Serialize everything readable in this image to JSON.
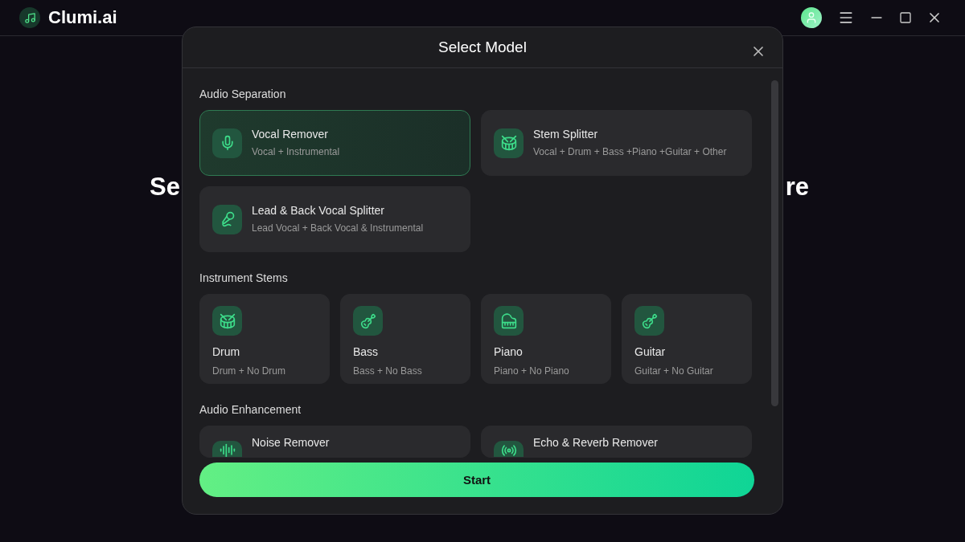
{
  "app": {
    "name": "Clumi.ai"
  },
  "background_heading": {
    "left_part": "Se",
    "right_part": "re"
  },
  "dialog": {
    "title": "Select Model",
    "sections": [
      {
        "title": "Audio Separation",
        "kind": "wide",
        "models": [
          {
            "name": "Vocal Remover",
            "description": "Vocal + Instrumental",
            "selected": true
          },
          {
            "name": "Stem Splitter",
            "description": "Vocal + Drum + Bass +Piano +Guitar + Other",
            "selected": false
          },
          {
            "name": "Lead & Back Vocal Splitter",
            "description": "Lead Vocal + Back Vocal & Instrumental",
            "selected": false
          }
        ]
      },
      {
        "title": "Instrument Stems",
        "kind": "tile",
        "models": [
          {
            "name": "Drum",
            "description": "Drum + No Drum",
            "selected": false
          },
          {
            "name": "Bass",
            "description": "Bass + No Bass",
            "selected": false
          },
          {
            "name": "Piano",
            "description": "Piano + No Piano",
            "selected": false
          },
          {
            "name": "Guitar",
            "description": "Guitar + No Guitar",
            "selected": false
          }
        ]
      },
      {
        "title": "Audio Enhancement",
        "kind": "wide",
        "models": [
          {
            "name": "Noise Remover",
            "selected": false
          },
          {
            "name": "Echo & Reverb Remover",
            "selected": false
          }
        ]
      }
    ],
    "start_button": "Start"
  }
}
